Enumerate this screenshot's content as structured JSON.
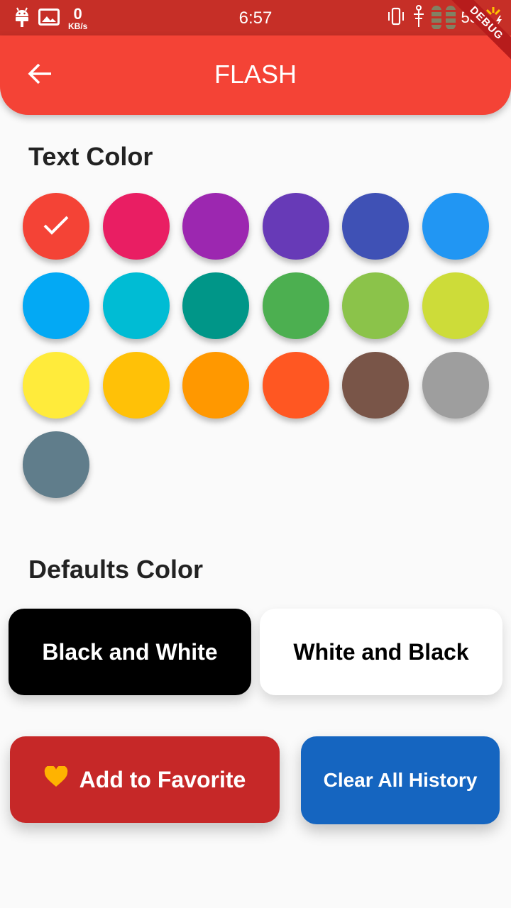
{
  "status_bar": {
    "time": "6:57",
    "net_speed_value": "0",
    "net_speed_unit": "KB/s",
    "battery": "53",
    "icons": [
      "android-debug-icon",
      "image-icon",
      "vibrate-icon",
      "signal-icon",
      "battery-charging-icon"
    ]
  },
  "debug_banner": "DEBUG",
  "app_bar": {
    "title": "FLASH",
    "back_icon": "arrow-back-icon",
    "color": "#f44336"
  },
  "text_color_section": {
    "title": "Text Color",
    "selected_index": 0,
    "check_icon": "check-icon",
    "colors": [
      "#f44336",
      "#e91e63",
      "#9c27b0",
      "#673ab7",
      "#3f51b5",
      "#2196f3",
      "#03a9f4",
      "#00bcd4",
      "#009688",
      "#4caf50",
      "#8bc34a",
      "#cddc39",
      "#ffeb3b",
      "#ffc107",
      "#ff9800",
      "#ff5722",
      "#795548",
      "#9e9e9e",
      "#607d8b"
    ]
  },
  "defaults_section": {
    "title": "Defaults Color",
    "black_white_label": "Black and White",
    "white_black_label": "White and Black"
  },
  "actions": {
    "favorite_label": "Add to Favorite",
    "favorite_icon": "heart-icon",
    "favorite_icon_color": "#ffb300",
    "clear_label": "Clear All History"
  }
}
